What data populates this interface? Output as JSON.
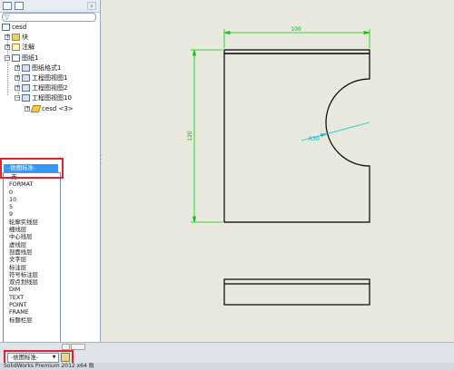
{
  "tree": {
    "root": "cesd",
    "nodes": [
      {
        "label": "块",
        "icon": "block-folder-icon"
      },
      {
        "label": "注解",
        "icon": "annotation-icon"
      },
      {
        "label": "图纸1",
        "icon": "sheet-icon"
      },
      {
        "label": "图纸格式1",
        "icon": "sheet-format-icon"
      },
      {
        "label": "工程图视图1",
        "icon": "drawing-view-icon"
      },
      {
        "label": "工程图视图2",
        "icon": "drawing-view-icon"
      },
      {
        "label": "工程图视图10",
        "icon": "drawing-view-icon"
      },
      {
        "label": "cesd <3>",
        "icon": "part-icon"
      }
    ]
  },
  "layer_dropdown": {
    "selected": "-依图标准-",
    "items": [
      "-无-",
      "FORMAT",
      "0",
      "10",
      "5",
      "9",
      "轮廓实线层",
      "细线层",
      "中心线层",
      "虚线层",
      "剖面线层",
      "文字层",
      "标注层",
      "符号标注层",
      "双点划线层",
      "DIM",
      "TEXT",
      "POINT",
      "FRAME",
      "标题栏层"
    ]
  },
  "layer_combo": {
    "value": "-依图标准-"
  },
  "drawing": {
    "dim_width": "100",
    "dim_height": "120",
    "dim_radius": "R30"
  },
  "status": {
    "text": "SolidWorks Premium 2012 x64 版"
  },
  "colors": {
    "dimension": "#00cc00",
    "leader": "#00cccc",
    "highlight": "#e0242a",
    "selection": "#3399ff"
  }
}
